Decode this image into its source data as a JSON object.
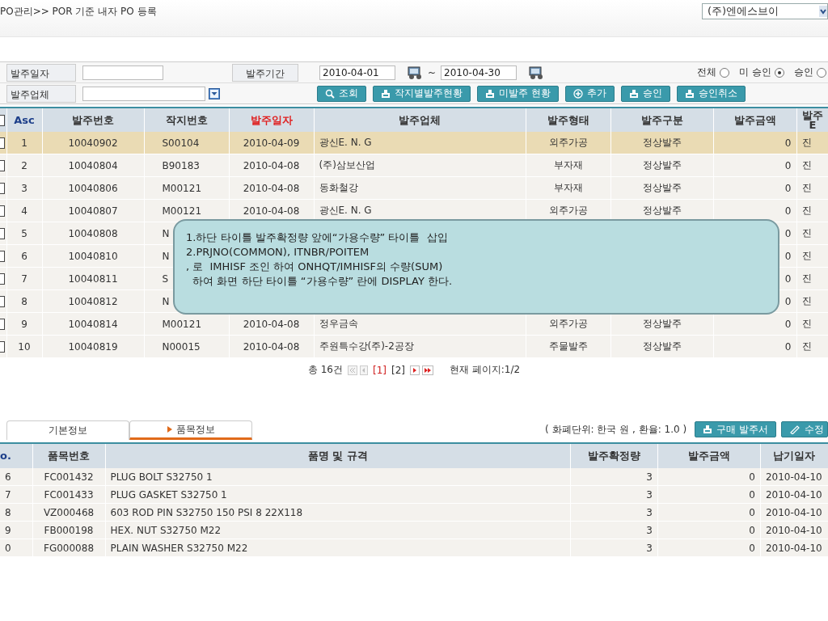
{
  "breadcrumb": "PO관리>> POR 기준 내자 PO 등록",
  "company_select": {
    "value": "(주)엔에스브이"
  },
  "filters": {
    "order_date": {
      "label": "발주일자"
    },
    "period": {
      "label": "발주기간",
      "from": "2010-04-01",
      "separator": "~",
      "to": "2010-04-30"
    },
    "vendor": {
      "label": "발주업체"
    },
    "approval": [
      {
        "label": "전체",
        "selected": false
      },
      {
        "label": "미 승인",
        "selected": true
      },
      {
        "label": "승인",
        "selected": false
      }
    ]
  },
  "actions": [
    {
      "label": "조회",
      "kind": "search"
    },
    {
      "label": "작지별발주현황",
      "kind": "stamp"
    },
    {
      "label": "미발주 현황",
      "kind": "stamp"
    },
    {
      "label": "추가",
      "kind": "plus"
    },
    {
      "label": "승인",
      "kind": "stamp"
    },
    {
      "label": "승인취소",
      "kind": "stamp"
    }
  ],
  "orders": {
    "all_checked": false,
    "columns": [
      {
        "label": "Asc",
        "kind": "sort"
      },
      {
        "label": "발주번호",
        "kind": "plain"
      },
      {
        "label": "작지번호",
        "kind": "plain"
      },
      {
        "label": "발주일자",
        "kind": "sorted"
      },
      {
        "label": "발주업체",
        "kind": "plain"
      },
      {
        "label": "발주형태",
        "kind": "plain"
      },
      {
        "label": "발주구분",
        "kind": "plain"
      },
      {
        "label": "발주금액",
        "kind": "plain"
      },
      {
        "label": "발주 E",
        "kind": "plain"
      }
    ],
    "rows": [
      {
        "selected": true,
        "checked": false,
        "cells": [
          "1",
          "10040902",
          "S00104",
          "2010-04-09",
          "광신E. N. G",
          "외주가공",
          "정상발주",
          "0",
          "진"
        ]
      },
      {
        "selected": false,
        "checked": false,
        "cells": [
          "2",
          "10040804",
          "B90183",
          "2010-04-08",
          "(주)삼보산업",
          "부자재",
          "정상발주",
          "0",
          "진"
        ]
      },
      {
        "selected": false,
        "checked": false,
        "cells": [
          "3",
          "10040806",
          "M00121",
          "2010-04-08",
          "동화철강",
          "부자재",
          "정상발주",
          "0",
          "진"
        ]
      },
      {
        "selected": false,
        "checked": false,
        "cells": [
          "4",
          "10040807",
          "M00121",
          "2010-04-08",
          "광신E. N. G",
          "외주가공",
          "정상발주",
          "0",
          "진"
        ]
      },
      {
        "selected": false,
        "checked": false,
        "cells": [
          "5",
          "10040808",
          "N",
          null,
          null,
          null,
          null,
          "0",
          "진"
        ]
      },
      {
        "selected": false,
        "checked": false,
        "cells": [
          "6",
          "10040810",
          "N",
          null,
          null,
          null,
          null,
          "0",
          "진"
        ]
      },
      {
        "selected": false,
        "checked": false,
        "cells": [
          "7",
          "10040811",
          "S",
          null,
          null,
          null,
          null,
          "0",
          "진"
        ]
      },
      {
        "selected": false,
        "checked": false,
        "cells": [
          "8",
          "10040812",
          "N",
          null,
          null,
          null,
          null,
          "0",
          "진"
        ]
      },
      {
        "selected": false,
        "checked": false,
        "cells": [
          "9",
          "10040814",
          "M00121",
          "2010-04-08",
          "정우금속",
          "외주가공",
          "정상발주",
          "0",
          "진"
        ]
      },
      {
        "selected": false,
        "checked": false,
        "cells": [
          "10",
          "10040819",
          "N00015",
          "2010-04-08",
          "주원특수강(주)-2공장",
          "주물발주",
          "정상발주",
          "0",
          "진"
        ]
      }
    ]
  },
  "callout": [
    "1.하단 타이틀 발주확정량 앞에“가용수량” 타이틀  삽입",
    "2.PRJNO(COMMON), ITNBR/POITEM",
    ", 로  IMHISF 조인 하여 ONHQT/IMHISF의 수량(SUM)",
    "  하여 화면 하단 타이틀 “가용수량” 란에 DISPLAY 한다."
  ],
  "pagination": {
    "total": "총 16건",
    "pages": [
      {
        "label": "[1]",
        "selected": true
      },
      {
        "label": "[2]",
        "selected": false
      }
    ],
    "current": "현재 페이지:1/2"
  },
  "tabs": [
    {
      "label": "기본정보",
      "selected": false
    },
    {
      "label": "품목정보",
      "selected": true
    }
  ],
  "currency_note": "( 화폐단위: 한국 원 , 환율: 1.0 )",
  "detail_buttons": [
    {
      "label": "구매 발주서",
      "kind": "stamp"
    },
    {
      "label": "수정",
      "kind": "pen"
    }
  ],
  "items": {
    "columns": [
      "o.",
      "품목번호",
      "품명 및 규격",
      "발주확정량",
      "발주금액",
      "납기일자"
    ],
    "rows": [
      [
        "6",
        "FC001432",
        "PLUG BOLT S32750 1",
        "3",
        "0",
        "2010-04-10"
      ],
      [
        "7",
        "FC001433",
        "PLUG GASKET S32750 1",
        "3",
        "0",
        "2010-04-10"
      ],
      [
        "8",
        "VZ000468",
        "603 ROD PIN S32750 150 PSI 8 22X118",
        "3",
        "0",
        "2010-04-10"
      ],
      [
        "9",
        "FB000198",
        "HEX. NUT S32750 M22",
        "3",
        "0",
        "2010-04-10"
      ],
      [
        "0",
        "FG000088",
        "PLAIN WASHER S32750 M22",
        "3",
        "0",
        "2010-04-10"
      ]
    ]
  }
}
